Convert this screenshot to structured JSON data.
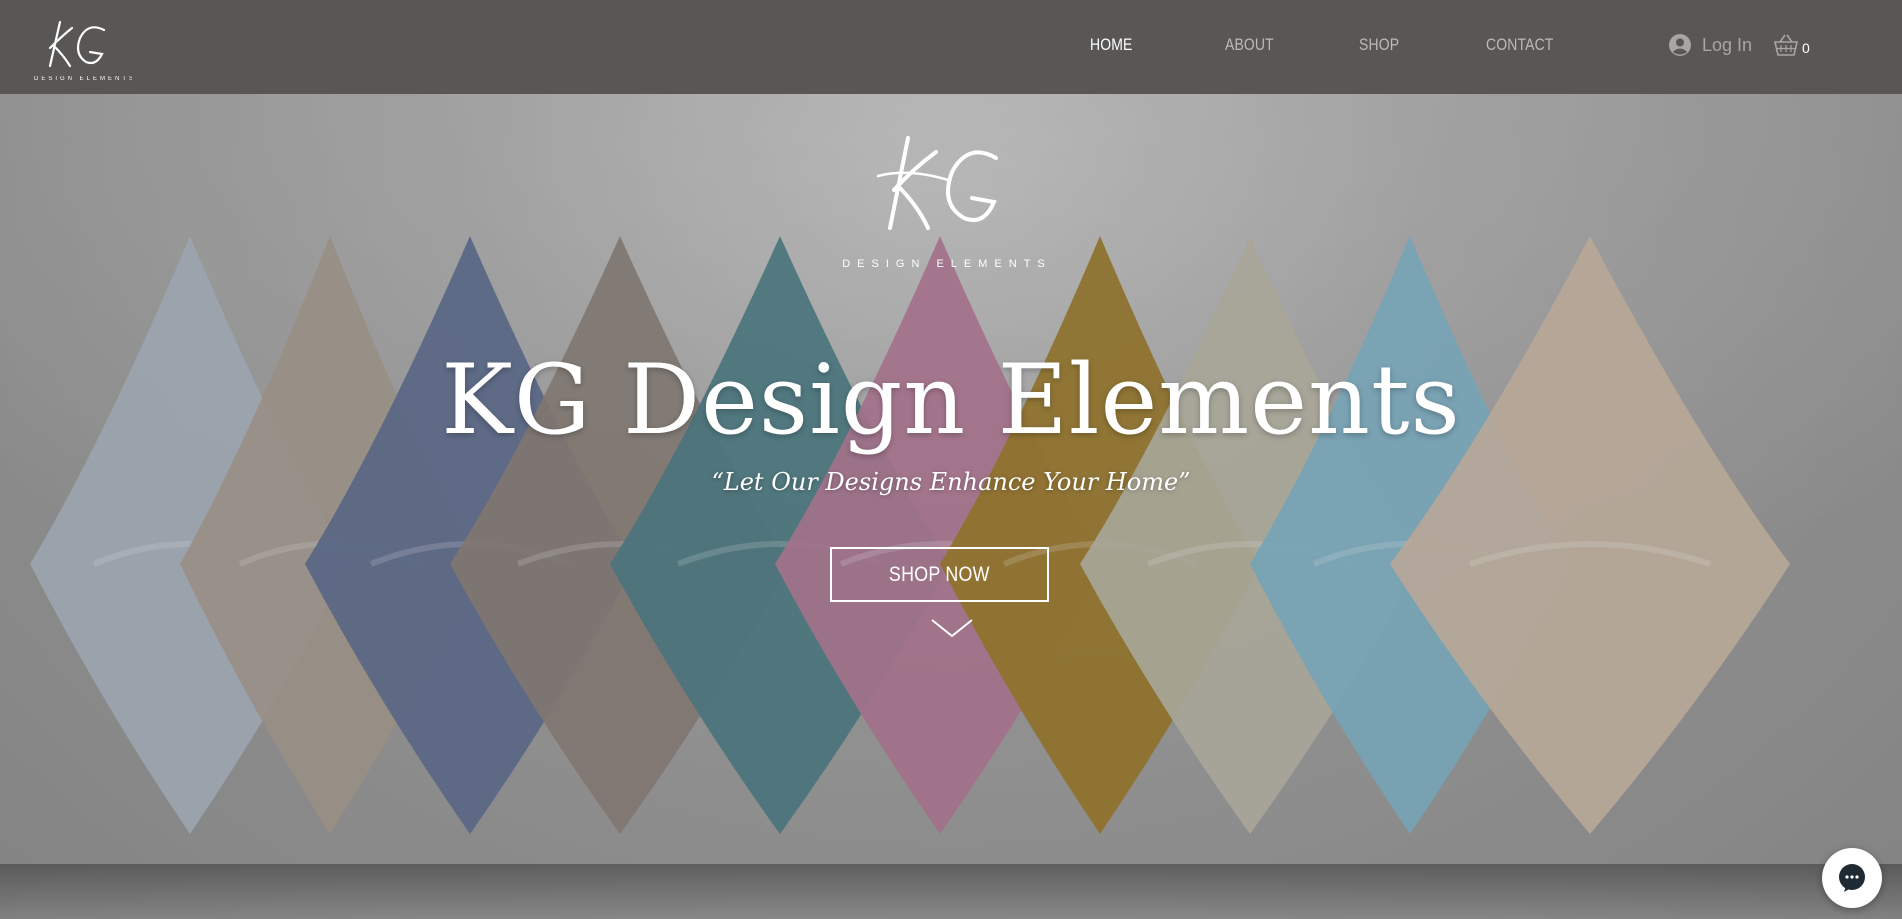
{
  "header": {
    "brand_logo_text": "KG",
    "brand_sub_text": "DESIGN ELEMENTS",
    "nav": [
      {
        "label": "HOME",
        "active": true
      },
      {
        "label": "ABOUT",
        "active": false
      },
      {
        "label": "SHOP",
        "active": false
      },
      {
        "label": "CONTACT",
        "active": false
      }
    ],
    "login_label": "Log In",
    "login_icon": "user-avatar-icon",
    "cart_icon": "shopping-basket-icon",
    "cart_count": "0"
  },
  "hero": {
    "logo_text": "KG",
    "logo_sub_text": "DESIGN ELEMENTS",
    "title": "KG Design Elements",
    "tagline": "“Let Our Designs Enhance Your Home”",
    "button_label": "SHOP NOW",
    "scroll_icon": "chevron-down-icon",
    "background": "row of decorative throw pillows",
    "pillow_colors": [
      "#a9b3bf",
      "#a59b90",
      "#5d6c8f",
      "#8a7f78",
      "#4d7d86",
      "#b27a96",
      "#9a7a2a",
      "#b7b5a6",
      "#7fb2c7",
      "#c9b7a5"
    ]
  },
  "chat": {
    "icon": "chat-bubble-icon"
  },
  "colors": {
    "header_bg": "#585756",
    "nav_active": "#ffffff",
    "nav_inactive": "#bdbbb8",
    "hero_text": "#ffffff"
  }
}
